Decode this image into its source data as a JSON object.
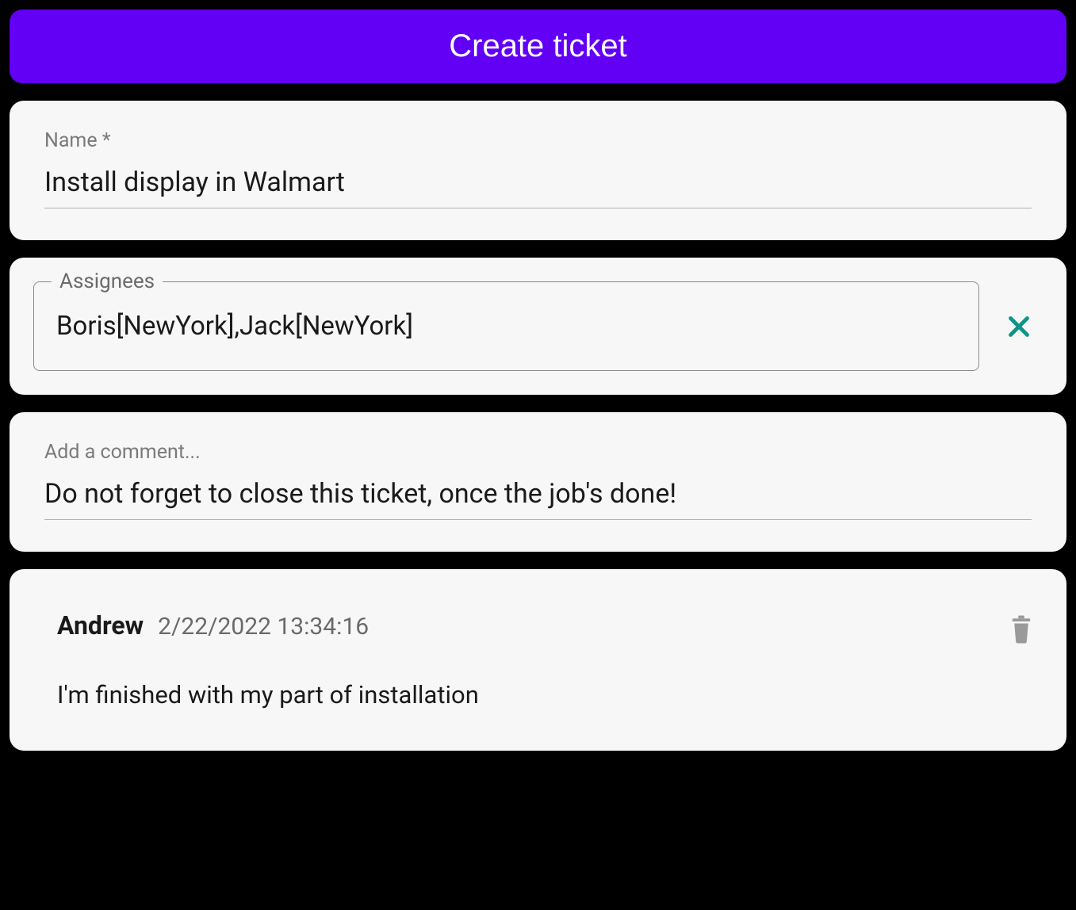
{
  "header": {
    "title": "Create ticket"
  },
  "nameField": {
    "label": "Name *",
    "value": "Install display in Walmart"
  },
  "assigneesField": {
    "label": "Assignees",
    "value": "Boris[NewYork],Jack[NewYork]"
  },
  "commentField": {
    "label": "Add a comment...",
    "value": "Do not forget to close this ticket, once the job's done!"
  },
  "comments": [
    {
      "author": "Andrew",
      "timestamp": "2/22/2022 13:34:16",
      "body": "I'm finished with my part of installation"
    }
  ],
  "colors": {
    "accent": "#6200f5",
    "iconTeal": "#0d9488",
    "iconGray": "#9a9a9a"
  }
}
